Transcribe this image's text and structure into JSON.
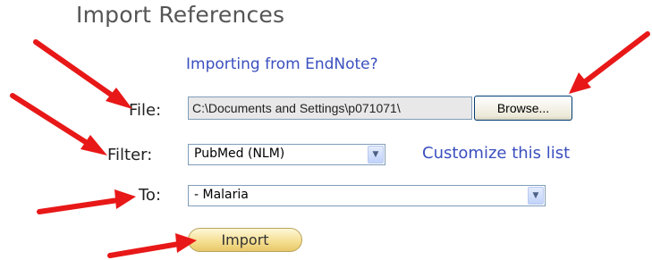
{
  "page": {
    "title": "Import References",
    "endnote_link": "Importing from EndNote?"
  },
  "form": {
    "file": {
      "label": "File:",
      "value": "C:\\Documents and Settings\\p071071\\",
      "browse_label": "Browse..."
    },
    "filter": {
      "label": "Filter:",
      "selected": "PubMed (NLM)",
      "customize_link": "Customize this list"
    },
    "to": {
      "label": "To:",
      "selected": "- Malaria"
    },
    "import_label": "Import"
  },
  "annotations": {
    "arrow_color": "#e81818",
    "arrow_count": 5
  },
  "icons": {
    "dropdown": "chevron-down-icon",
    "arrow": "red-arrow-icon"
  }
}
